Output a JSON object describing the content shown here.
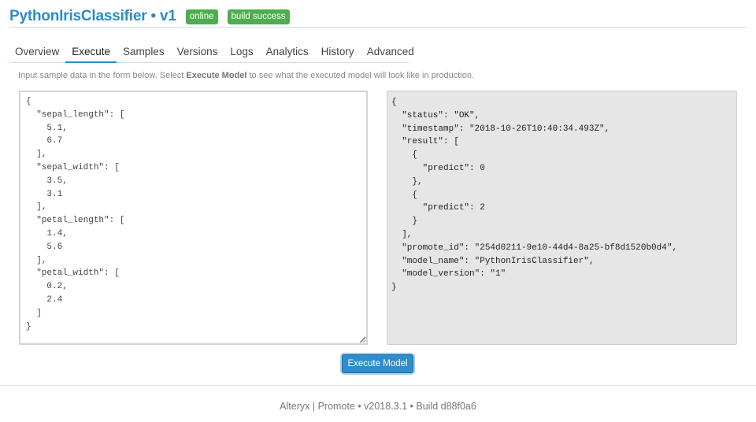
{
  "header": {
    "title": "PythonIrisClassifier • v1",
    "badges": [
      "online",
      "build success"
    ],
    "badge_color": "#4cae4c",
    "title_color": "#2a8cc7"
  },
  "tabs": [
    {
      "label": "Overview",
      "active": false
    },
    {
      "label": "Execute",
      "active": true
    },
    {
      "label": "Samples",
      "active": false
    },
    {
      "label": "Versions",
      "active": false
    },
    {
      "label": "Logs",
      "active": false
    },
    {
      "label": "Analytics",
      "active": false
    },
    {
      "label": "History",
      "active": false
    },
    {
      "label": "Advanced",
      "active": false
    }
  ],
  "instruction": {
    "before": "Input sample data in the form below. Select ",
    "bold": "Execute Model",
    "after": " to see what the executed model will look like in production."
  },
  "input_json": "{\n  \"sepal_length\": [\n    5.1,\n    6.7\n  ],\n  \"sepal_width\": [\n    3.5,\n    3.1\n  ],\n  \"petal_length\": [\n    1.4,\n    5.6\n  ],\n  \"petal_width\": [\n    0.2,\n    2.4\n  ]\n}",
  "output_json": "{\n  \"status\": \"OK\",\n  \"timestamp\": \"2018-10-26T10:40:34.493Z\",\n  \"result\": [\n    {\n      \"predict\": 0\n    },\n    {\n      \"predict\": 2\n    }\n  ],\n  \"promote_id\": \"254d0211-9e10-44d4-8a25-bf8d1520b0d4\",\n  \"model_name\": \"PythonIrisClassifier\",\n  \"model_version\": \"1\"\n}",
  "execute_button": "Execute Model",
  "footer": "Alteryx | Promote • v2018.3.1 • Build d88f0a6",
  "icons": {
    "resize_grip": "resize-grip-icon"
  }
}
